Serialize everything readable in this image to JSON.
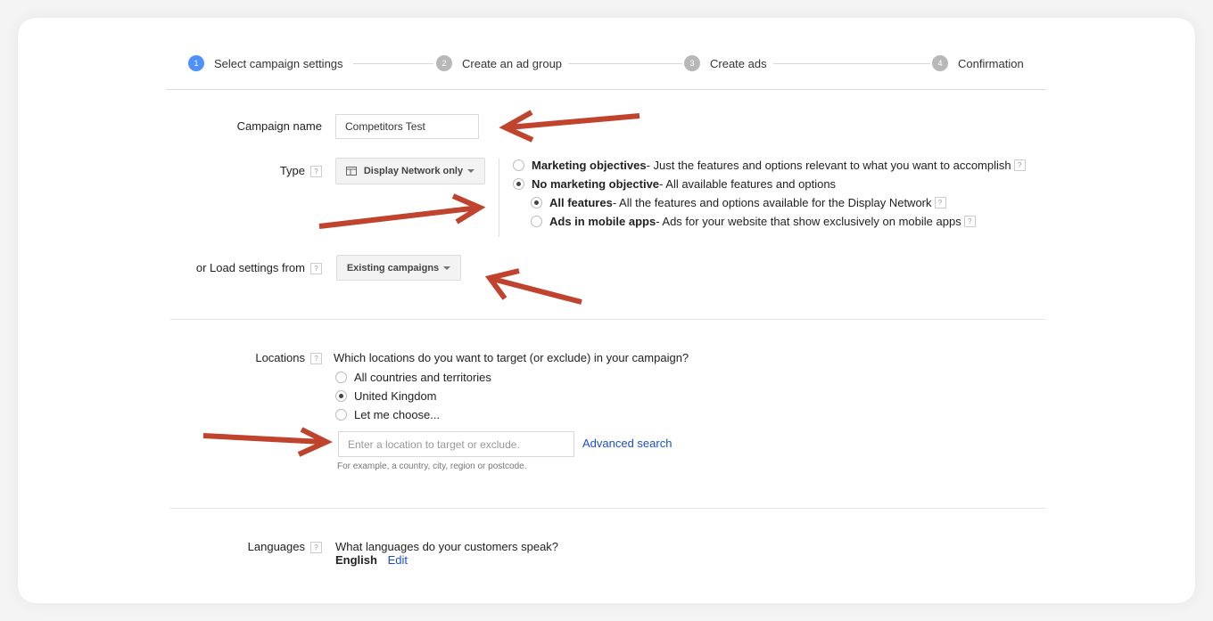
{
  "stepper": {
    "steps": [
      {
        "number": "1",
        "label": "Select campaign settings",
        "active": true
      },
      {
        "number": "2",
        "label": "Create an ad group",
        "active": false
      },
      {
        "number": "3",
        "label": "Create ads",
        "active": false
      },
      {
        "number": "4",
        "label": "Confirmation",
        "active": false
      }
    ]
  },
  "help_glyph": "?",
  "campaign_name": {
    "label": "Campaign name",
    "value": "Competitors Test"
  },
  "type": {
    "label": "Type",
    "dropdown_label": "Display Network only",
    "options": [
      {
        "title": "Marketing objectives",
        "desc": " - Just the features and options relevant to what you want to accomplish",
        "checked": false,
        "help": true
      },
      {
        "title": "No marketing objective",
        "desc": " - All available features and options",
        "checked": true,
        "help": false
      }
    ],
    "sub_options": [
      {
        "title": "All features",
        "desc": " - All the features and options available for the Display Network",
        "checked": true,
        "help": true
      },
      {
        "title": "Ads in mobile apps",
        "desc": " - Ads for your website that show exclusively on mobile apps",
        "checked": false,
        "help": true
      }
    ]
  },
  "load_settings": {
    "label": "or Load settings from",
    "button_label": "Existing campaigns"
  },
  "locations": {
    "label": "Locations",
    "question": "Which locations do you want to target (or exclude) in your campaign?",
    "options": [
      {
        "label": "All countries and territories",
        "checked": false
      },
      {
        "label": "United Kingdom",
        "checked": true
      },
      {
        "label": "Let me choose...",
        "checked": false
      }
    ],
    "input_placeholder": "Enter a location to target or exclude.",
    "advanced_search": "Advanced search",
    "hint": "For example, a country, city, region or postcode."
  },
  "languages": {
    "label": "Languages",
    "question": "What languages do your customers speak?",
    "value": "English",
    "edit_label": "Edit"
  },
  "annotation_color": "#c0432e"
}
